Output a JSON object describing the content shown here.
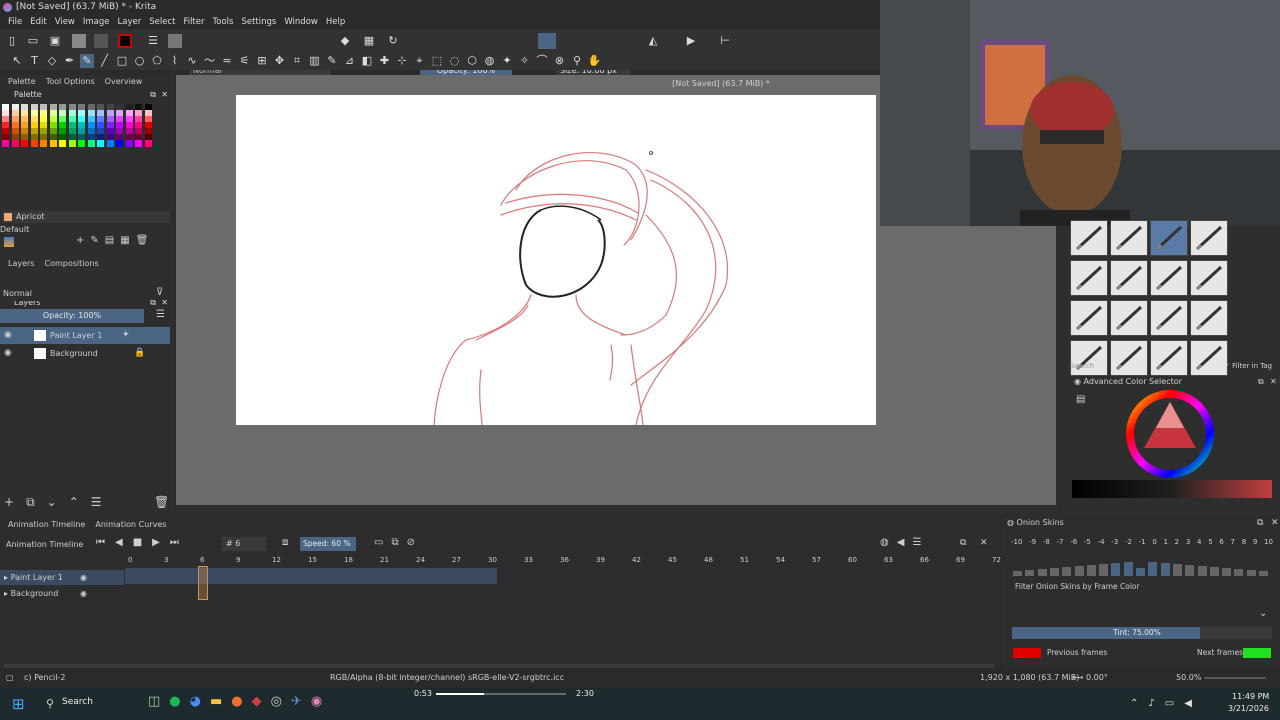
{
  "window": {
    "title": "[Not Saved]  (63.7 MiB) * - Krita"
  },
  "menu": [
    "File",
    "Edit",
    "View",
    "Image",
    "Layer",
    "Select",
    "Filter",
    "Tools",
    "Settings",
    "Window",
    "Help"
  ],
  "toolbar": {
    "blend_mode": "Normal",
    "opacity": "Opacity: 100%",
    "size": "Size: 10.00 px"
  },
  "canvas_header": "[Not Saved]  (63.7 MiB) *",
  "left_tabs": [
    "Palette",
    "Tool Options",
    "Overview"
  ],
  "palette": {
    "title": "Palette",
    "selected_color_name": "Apricot",
    "preset": "Default",
    "colors": [
      "#ffffff",
      "#eeeeee",
      "#dddddd",
      "#cccccc",
      "#bbbbbb",
      "#aaaaaa",
      "#999999",
      "#888888",
      "#777777",
      "#666666",
      "#555555",
      "#444444",
      "#333333",
      "#222222",
      "#111111",
      "#000000",
      "#ffe0e0",
      "#ffd0a0",
      "#ffe8a0",
      "#ffffa0",
      "#ffff80",
      "#e0ffa0",
      "#c0ffc0",
      "#a0ffd0",
      "#a0ffff",
      "#a0e0ff",
      "#a0c0ff",
      "#c0a0ff",
      "#e0a0ff",
      "#ffa0ff",
      "#ffa0d0",
      "#ffc0c0",
      "#ff8080",
      "#ffa060",
      "#ffc060",
      "#ffe060",
      "#ffff40",
      "#c0ff40",
      "#60ff60",
      "#40ffb0",
      "#40ffff",
      "#40c0ff",
      "#6080ff",
      "#a060ff",
      "#e040ff",
      "#ff40ff",
      "#ff40a0",
      "#ff6060",
      "#ff2020",
      "#ff7020",
      "#ffa020",
      "#ffcc00",
      "#e0e000",
      "#80e000",
      "#00d000",
      "#00c080",
      "#00c0c0",
      "#0090ff",
      "#3050ff",
      "#8020ff",
      "#c000ff",
      "#ff00e0",
      "#ff0080",
      "#e00000",
      "#c00000",
      "#d05000",
      "#d08000",
      "#c0a000",
      "#a0a000",
      "#60a000",
      "#00a000",
      "#00a060",
      "#00a0a0",
      "#0070d0",
      "#2040c0",
      "#6000c0",
      "#a000c0",
      "#c000a0",
      "#c00060",
      "#a00000",
      "#800000",
      "#904000",
      "#906000",
      "#807000",
      "#707000",
      "#406000",
      "#006000",
      "#006040",
      "#006060",
      "#004080",
      "#102070",
      "#400080",
      "#600070",
      "#700050",
      "#700030",
      "#500000",
      "#ff00a0",
      "#ff0060",
      "#ff0000",
      "#ff4000",
      "#ff8000",
      "#ffc000",
      "#ffff00",
      "#a0ff00",
      "#00ff00",
      "#00ff80",
      "#00ffff",
      "#0080ff",
      "#0000ff",
      "#8000ff",
      "#ff00ff",
      "#ff0080"
    ]
  },
  "layers_panel": {
    "tabs": [
      "Layers",
      "Compositions"
    ],
    "title": "Layers",
    "blend_mode": "Normal",
    "opacity": "Opacity: 100%",
    "layers": [
      {
        "name": "Paint Layer 1",
        "selected": true
      },
      {
        "name": "Background",
        "selected": false
      }
    ]
  },
  "brush_panel": {
    "search_placeholder": "Search",
    "filter_tag": "Filter in Tag"
  },
  "color_selector": {
    "title": "Advanced Color Selector"
  },
  "timeline": {
    "tabs": [
      "Animation Timeline",
      "Animation Curves"
    ],
    "title": "Animation Timeline",
    "frame": "# 6",
    "speed": "Speed: 60 %",
    "frame_numbers": [
      "0",
      "3",
      "6",
      "9",
      "12",
      "15",
      "18",
      "21",
      "24",
      "27",
      "30",
      "33",
      "36",
      "39",
      "42",
      "45",
      "48",
      "51",
      "54",
      "57",
      "60",
      "63",
      "66",
      "69",
      "72"
    ],
    "layers": [
      "Paint Layer 1",
      "Background"
    ]
  },
  "onion_skins": {
    "title": "Onion Skins",
    "numbers": [
      "-10",
      "-9",
      "-8",
      "-7",
      "-6",
      "-5",
      "-4",
      "-3",
      "-2",
      "-1",
      "0",
      "1",
      "2",
      "3",
      "4",
      "5",
      "6",
      "7",
      "8",
      "9",
      "10"
    ],
    "filter_label": "Filter Onion Skins by Frame Color",
    "tint": "Tint: 75.00%",
    "tint_fraction": 0.75,
    "previous_label": "Previous frames",
    "next_label": "Next frames",
    "previous_color": "#e00000",
    "next_color": "#20e020"
  },
  "status": {
    "tool": "c) Pencil-2",
    "color_space": "RGB/Alpha (8-bit integer/channel)  sRGB-elle-V2-srgbtrc.icc",
    "dimensions": "1,920 x 1,080 (63.7 MiB)",
    "rotation": "0.00°",
    "zoom": "50.0%"
  },
  "media": {
    "elapsed": "0:53",
    "total": "2:30"
  },
  "taskbar": {
    "search": "Search",
    "time": "11:49 PM",
    "date": "3/21/2026"
  }
}
